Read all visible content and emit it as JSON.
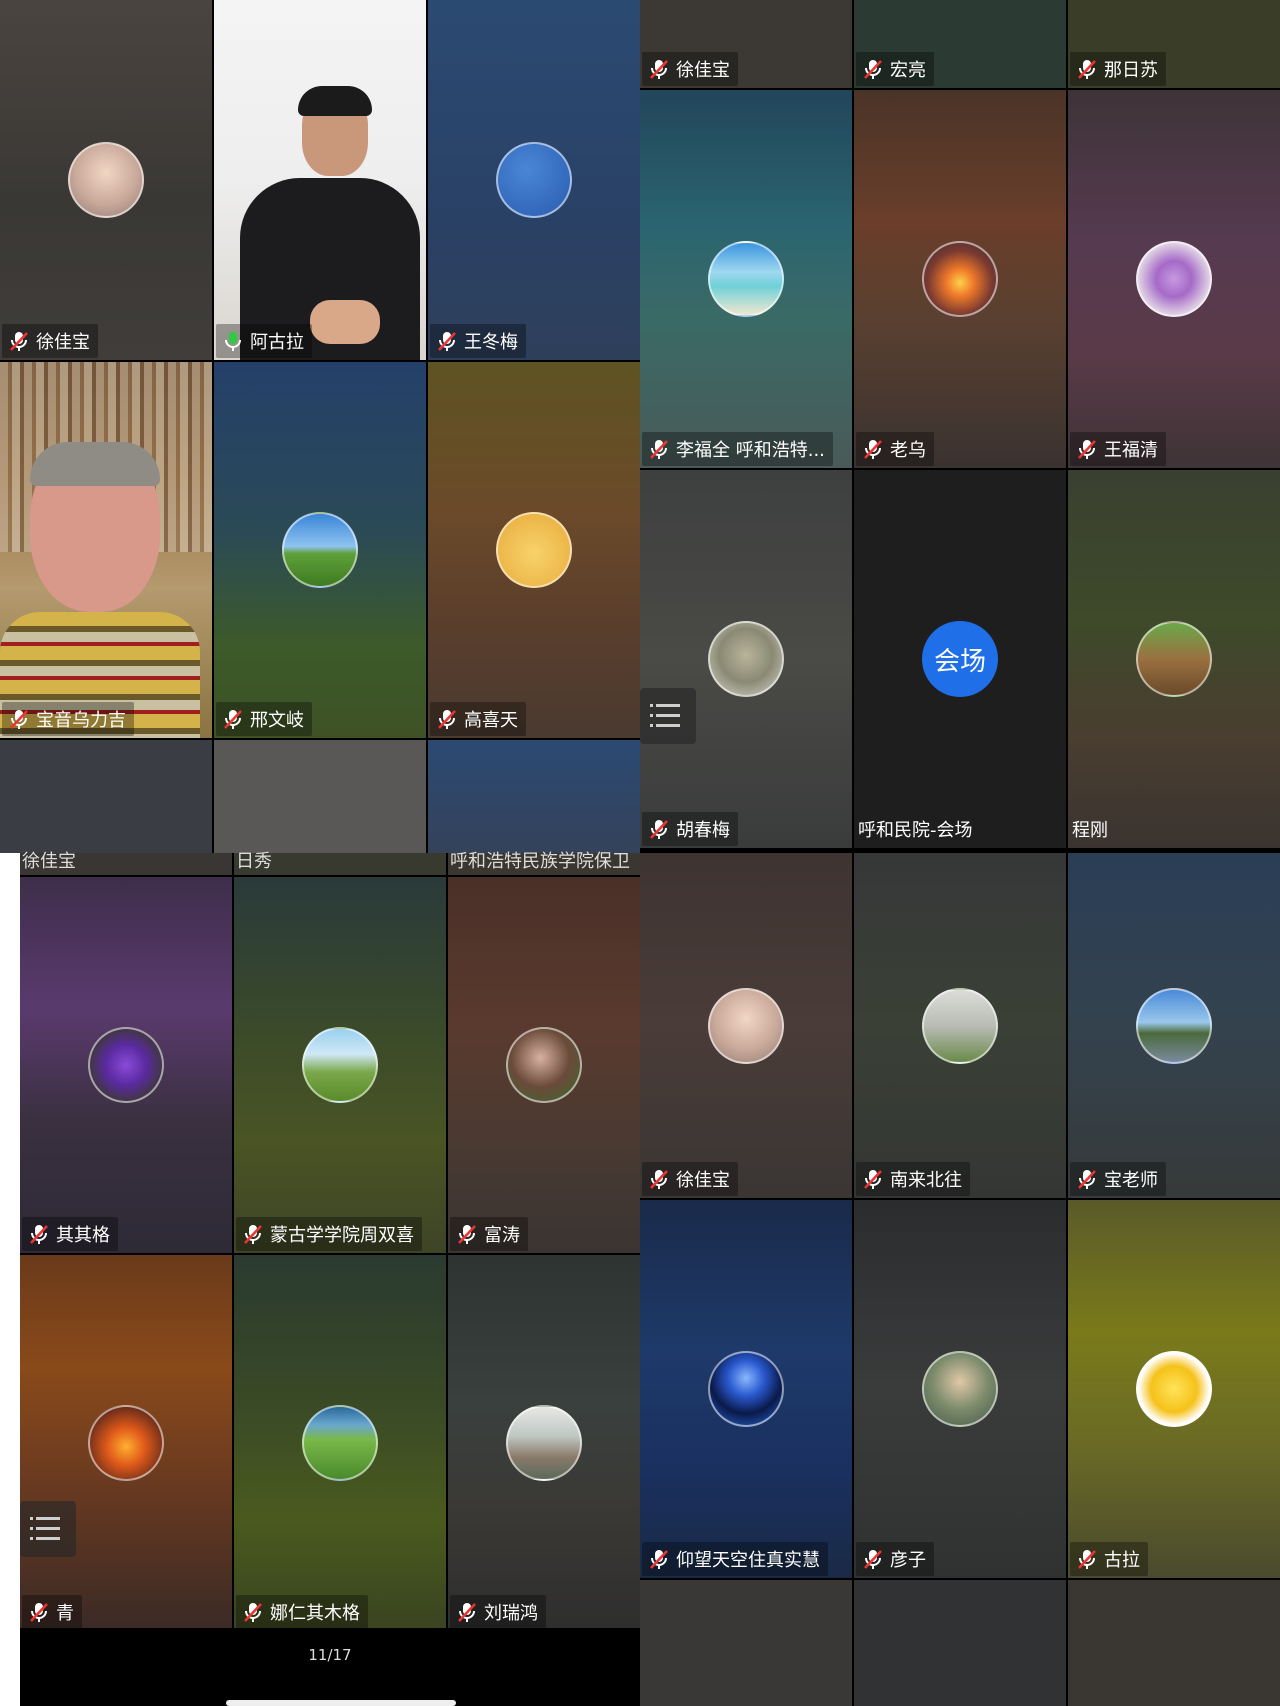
{
  "q1": {
    "tiles": [
      {
        "name": "徐佳宝",
        "mic": "muted"
      },
      {
        "name": "阿古拉",
        "mic": "active"
      },
      {
        "name": "王冬梅",
        "mic": "muted"
      },
      {
        "name": "宝音乌力吉",
        "mic": "muted"
      },
      {
        "name": "邢文岐",
        "mic": "muted"
      },
      {
        "name": "高喜天",
        "mic": "muted"
      }
    ]
  },
  "q2": {
    "top_partial": [
      {
        "name": "徐佳宝",
        "mic": "muted"
      },
      {
        "name": "宏亮",
        "mic": "muted"
      },
      {
        "name": "那日苏",
        "mic": "muted"
      }
    ],
    "tiles": [
      {
        "name": "李福全 呼和浩特...",
        "mic": "muted"
      },
      {
        "name": "老乌",
        "mic": "muted"
      },
      {
        "name": "王福清",
        "mic": "muted"
      },
      {
        "name": "胡春梅",
        "mic": "muted"
      },
      {
        "name": "呼和民院-会场",
        "mic": "none",
        "avatar_text": "会场"
      },
      {
        "name": "程刚",
        "mic": "none"
      }
    ]
  },
  "q3": {
    "top_partial": [
      "徐佳宝",
      "日秀",
      "呼和浩特民族学院保卫"
    ],
    "tiles": [
      {
        "name": "其其格",
        "mic": "muted"
      },
      {
        "name": "蒙古学学院周双喜",
        "mic": "muted"
      },
      {
        "name": "富涛",
        "mic": "muted"
      },
      {
        "name": "青",
        "mic": "muted"
      },
      {
        "name": "娜仁其木格",
        "mic": "muted"
      },
      {
        "name": "刘瑞鸿",
        "mic": "muted"
      }
    ],
    "page_indicator": "11/17"
  },
  "q4": {
    "tiles": [
      {
        "name": "徐佳宝",
        "mic": "muted"
      },
      {
        "name": "南来北往",
        "mic": "muted"
      },
      {
        "name": "宝老师",
        "mic": "muted"
      },
      {
        "name": "仰望天空住真实慧",
        "mic": "muted"
      },
      {
        "name": "彦子",
        "mic": "muted"
      },
      {
        "name": "古拉",
        "mic": "muted"
      }
    ]
  },
  "colors": {
    "hall_avatar": "#1e6fe8",
    "mic_active": "#2ecc40",
    "label_bg": "rgba(0,0,0,0.32)"
  }
}
